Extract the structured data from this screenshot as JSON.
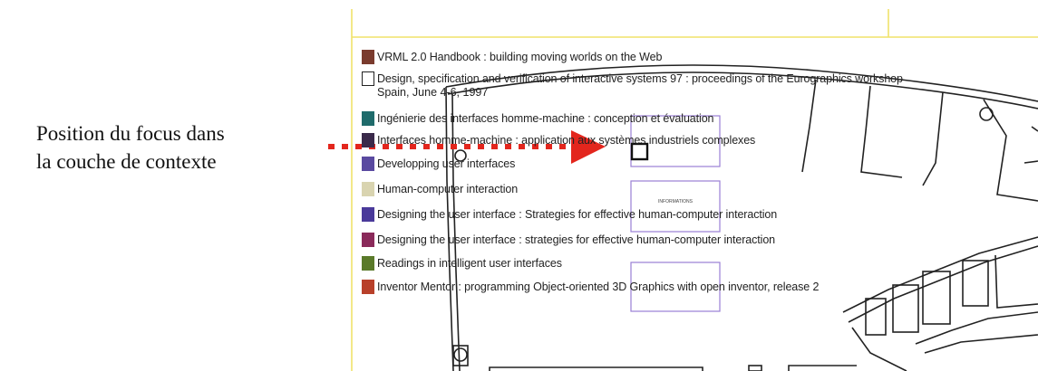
{
  "caption": {
    "line1": "Position du focus dans",
    "line2": "la couche de contexte"
  },
  "colors": {
    "arrow": "#e3261d",
    "frame": "#f0e26a",
    "lens": "#9a7fd4",
    "focus": "#111111",
    "plan": "#222222"
  },
  "books": [
    {
      "title": "VRML 2.0 Handbook : building moving worlds on the Web",
      "icon": "book-cover-icon",
      "color": "#7a3b2e"
    },
    {
      "title": "Design, specification and verification of interactive systems 97 : proceedings of the Eurographics workshop",
      "subline": "Spain, June 4-6, 1997",
      "icon": "blank-cover-icon",
      "color": "#ffffff"
    },
    {
      "title": "Ingénierie des interfaces homme-machine : conception et évaluation",
      "icon": "book-cover-icon",
      "color": "#1f6b6b"
    },
    {
      "title": "Interfaces homme-machine : application aux systèmes industriels complexes",
      "icon": "book-cover-icon",
      "color": "#3a2a4a"
    },
    {
      "title": "Developping user interfaces",
      "icon": "book-cover-icon",
      "color": "#5a4aa0"
    },
    {
      "title": "Human-computer interaction",
      "icon": "book-cover-icon",
      "color": "#d9d4b0"
    },
    {
      "title": "Designing the user interface : Strategies for effective human-computer interaction",
      "icon": "book-cover-icon",
      "color": "#4a3a9a"
    },
    {
      "title": "Designing the user interface : strategies for effective human-computer interaction",
      "icon": "book-cover-icon",
      "color": "#8a2a5a"
    },
    {
      "title": "Readings in intelligent user interfaces",
      "icon": "book-cover-icon",
      "color": "#5a7a2a"
    },
    {
      "title": "Inventor Mentor : programming Object-oriented 3D Graphics with open inventor, release 2",
      "icon": "book-cover-icon",
      "color": "#b8402a"
    }
  ],
  "lens_labels": {
    "middle": "INFORMATIONS"
  }
}
